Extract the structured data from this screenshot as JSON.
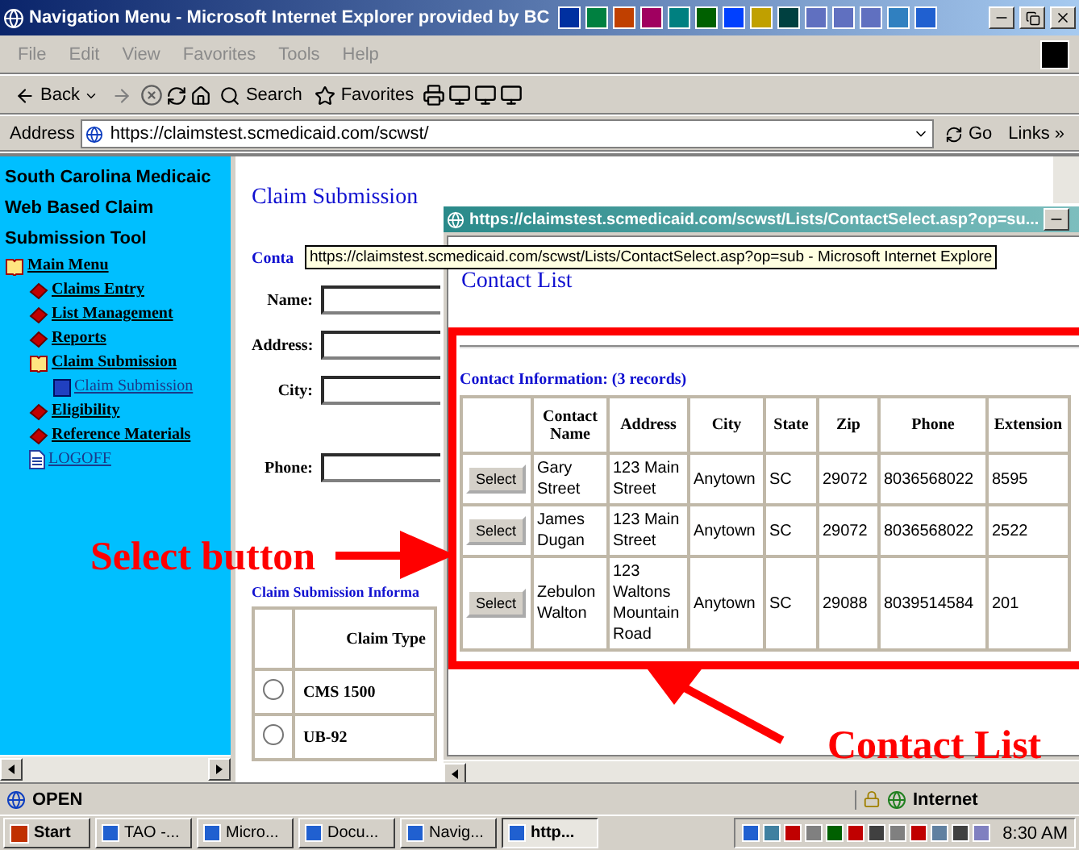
{
  "window": {
    "title": "Navigation Menu - Microsoft Internet Explorer provided by BC"
  },
  "menu": [
    {
      "label": "File"
    },
    {
      "label": "Edit"
    },
    {
      "label": "View"
    },
    {
      "label": "Favorites"
    },
    {
      "label": "Tools"
    },
    {
      "label": "Help"
    }
  ],
  "toolbar": {
    "back": "Back",
    "search": "Search",
    "favorites": "Favorites"
  },
  "address_bar": {
    "label": "Address",
    "value": "https://claimstest.scmedicaid.com/scwst/",
    "go": "Go",
    "links": "Links »"
  },
  "sidebar": {
    "title_lines": [
      "South Carolina Medicaic",
      "Web Based Claim",
      "Submission Tool"
    ],
    "items": [
      {
        "label": "Main Menu",
        "kind": "book",
        "expanded": true,
        "children": [
          {
            "label": "Claims Entry",
            "kind": "book",
            "expanded": false
          },
          {
            "label": "List Management",
            "kind": "book",
            "expanded": false
          },
          {
            "label": "Reports",
            "kind": "book",
            "expanded": false
          },
          {
            "label": "Claim Submission",
            "kind": "book",
            "expanded": true,
            "children": [
              {
                "label": "Claim Submission",
                "kind": "page"
              }
            ]
          },
          {
            "label": "Eligibility",
            "kind": "book",
            "expanded": false
          },
          {
            "label": "Reference Materials",
            "kind": "book",
            "expanded": false
          },
          {
            "label": "LOGOFF",
            "kind": "document"
          }
        ]
      }
    ]
  },
  "page": {
    "heading": "Claim Submission",
    "section": "Conta",
    "fields": [
      {
        "label": "Name:"
      },
      {
        "label": "Address:"
      },
      {
        "label": "City:"
      },
      {
        "label": "Phone:"
      }
    ],
    "claim_section": "Claim Submission Informa",
    "claim_table": {
      "columns": [
        "Claim Type"
      ],
      "rows": [
        {
          "label": "CMS 1500",
          "selected": false
        },
        {
          "label": "UB-92",
          "selected": false
        }
      ]
    }
  },
  "popup": {
    "title": "https://claimstest.scmedicaid.com/scwst/Lists/ContactSelect.asp?op=su...",
    "heading": "Contact List",
    "section": "Contact Information: (3 records)",
    "columns": [
      "Contact Name",
      "Address",
      "City",
      "State",
      "Zip",
      "Phone",
      "Extension"
    ],
    "rows": [
      {
        "button": "Select",
        "cells": [
          "Gary Street",
          "123 Main Street",
          "Anytown",
          "SC",
          "29072",
          "8036568022",
          "8595"
        ]
      },
      {
        "button": "Select",
        "cells": [
          "James Dugan",
          "123 Main Street",
          "Anytown",
          "SC",
          "29072",
          "8036568022",
          "2522"
        ]
      },
      {
        "button": "Select",
        "cells": [
          "Zebulon Walton",
          "123 Waltons Mountain Road",
          "Anytown",
          "SC",
          "29088",
          "8039514584",
          "201"
        ]
      }
    ]
  },
  "tooltip": "https://claimstest.scmedicaid.com/scwst/Lists/ContactSelect.asp?op=sub - Microsoft Internet Explore",
  "annotations": [
    {
      "text": "Select button"
    },
    {
      "text": "Contact List"
    }
  ],
  "status_bar": {
    "text": "OPEN",
    "zone": "Internet"
  },
  "taskbar": {
    "start": "Start",
    "buttons": [
      {
        "label": "TAO -...",
        "selected": false
      },
      {
        "label": "Micro...",
        "selected": false
      },
      {
        "label": "Docu...",
        "selected": false
      },
      {
        "label": "Navig...",
        "selected": false
      },
      {
        "label": "http...",
        "selected": true
      }
    ],
    "clock": "8:30 AM"
  }
}
